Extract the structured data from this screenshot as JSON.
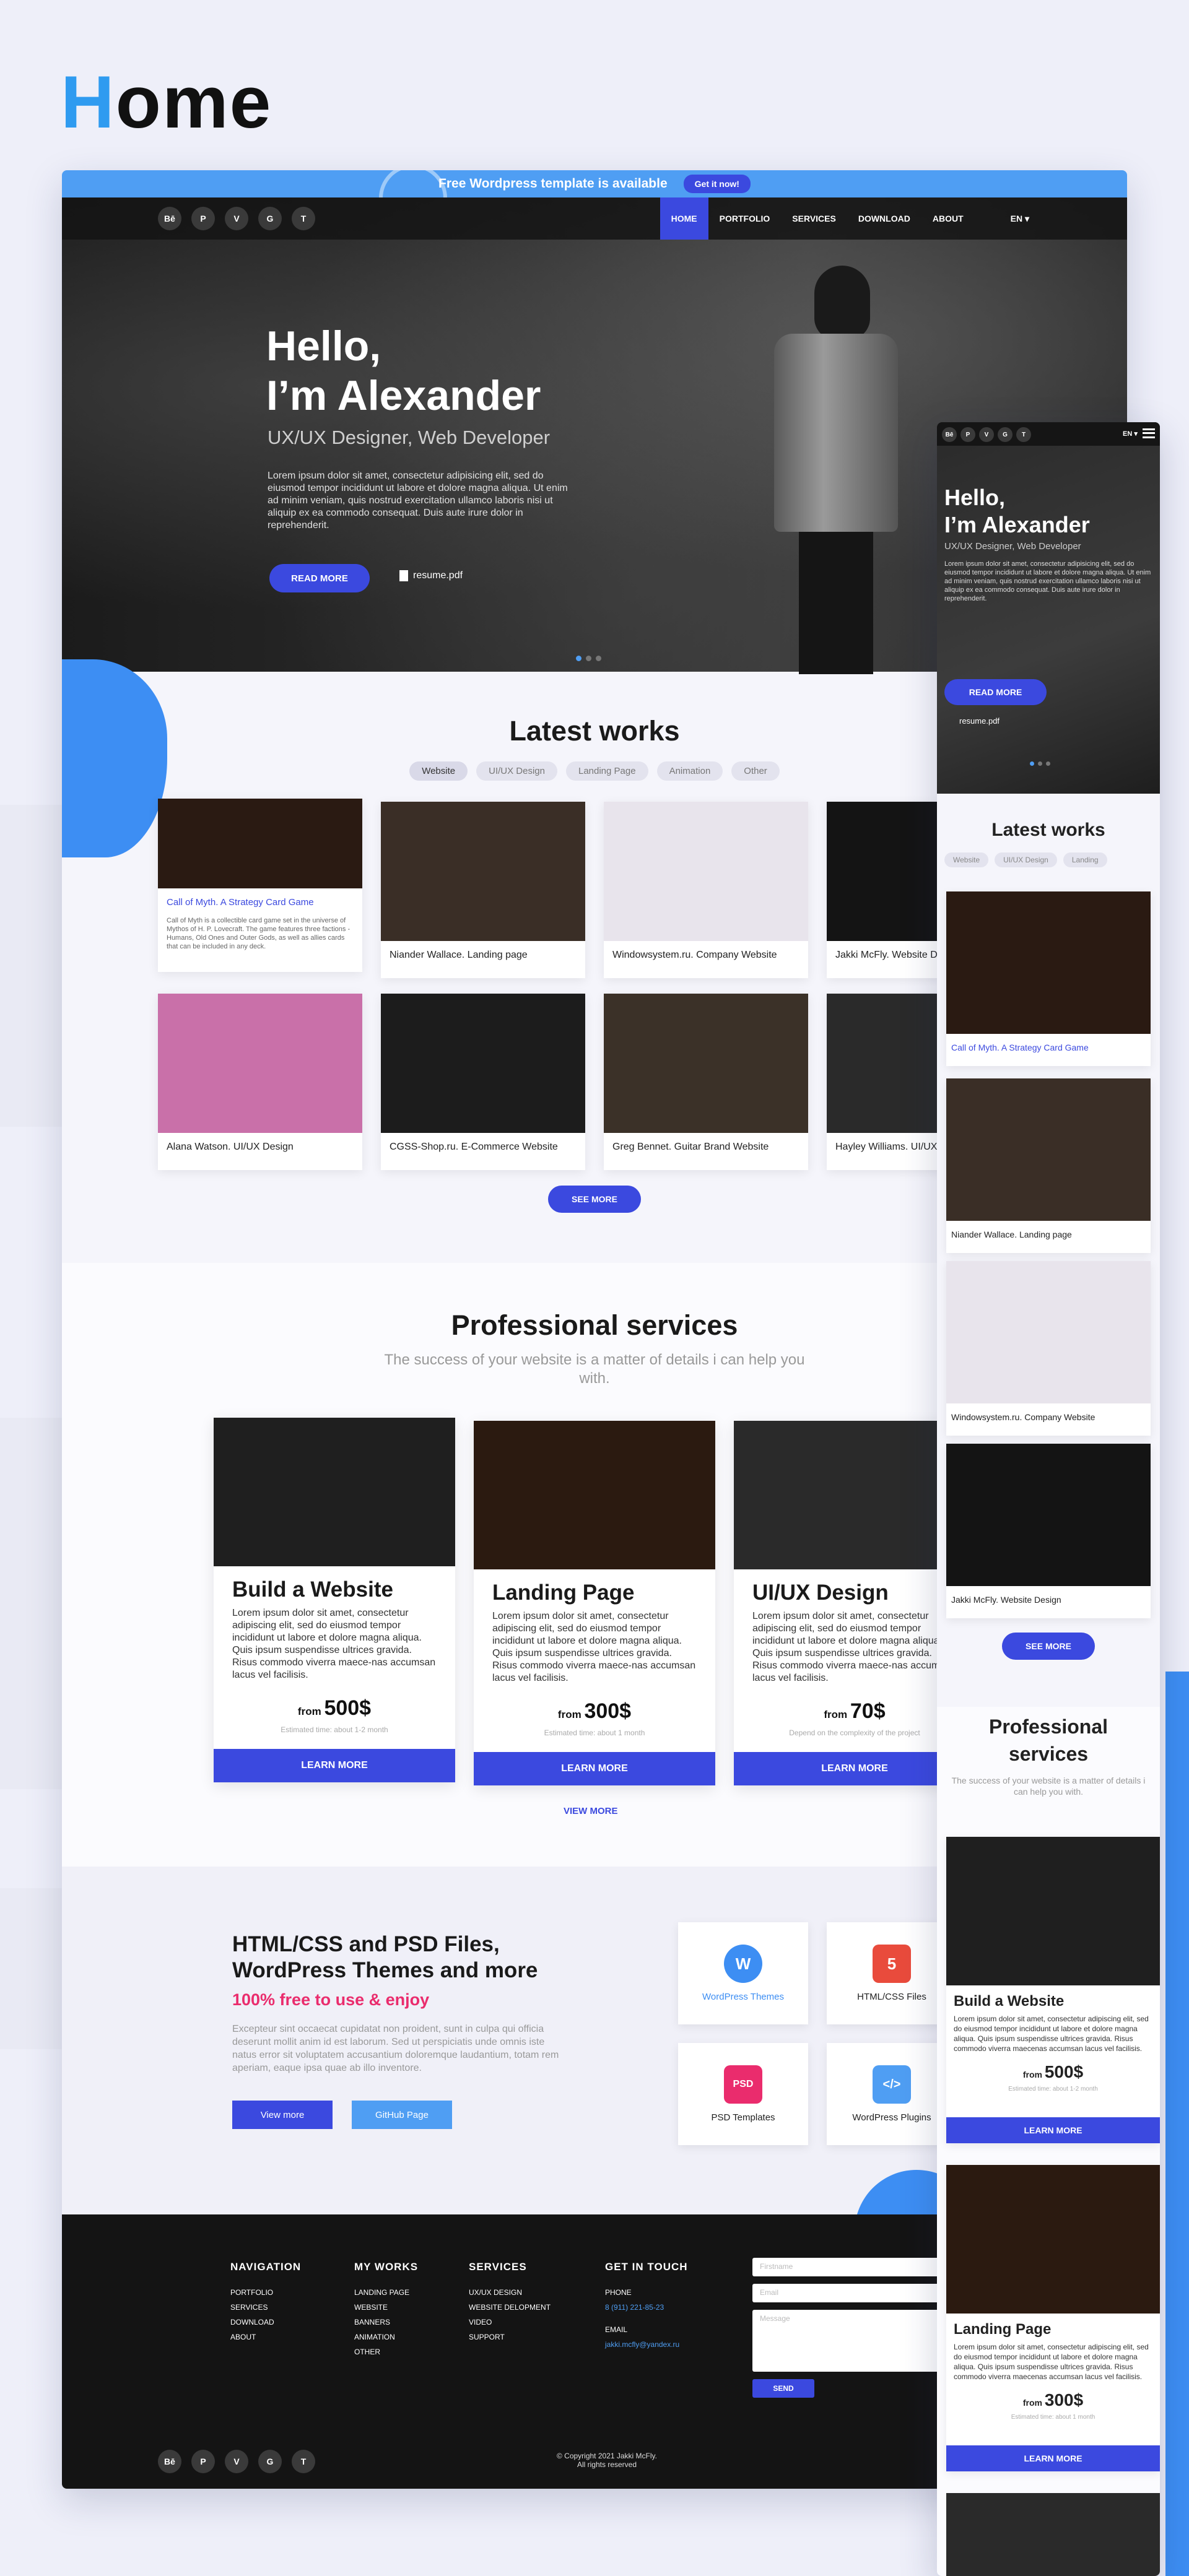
{
  "page_title": {
    "first_letter": "H",
    "rest": "ome"
  },
  "banner": {
    "text": "Free Wordpress template is available",
    "button": "Get it now!"
  },
  "nav": {
    "socials": [
      "Bē",
      "P",
      "V",
      "G",
      "T"
    ],
    "menu": [
      "HOME",
      "PORTFOLIO",
      "SERVICES",
      "DOWNLOAD",
      "ABOUT"
    ],
    "lang": "EN ▾"
  },
  "hero": {
    "hello1": "Hello,",
    "hello2": "I’m Alexander",
    "role": "UX/UX Designer, Web Developer",
    "text": "Lorem ipsum dolor sit amet, consectetur adipisicing elit, sed do eiusmod tempor incididunt ut labore et dolore magna aliqua. Ut enim ad minim veniam, quis nostrud exercitation ullamco laboris nisi ut aliquip ex ea commodo consequat. Duis aute irure dolor in reprehenderit.",
    "button": "READ MORE",
    "resume": "resume.pdf"
  },
  "works": {
    "title": "Latest works",
    "filters": [
      "Website",
      "UI/UX Design",
      "Landing Page",
      "Animation",
      "Other"
    ],
    "items": [
      {
        "caption": "Call of Myth. A Strategy Card Game",
        "desc": "Call of Myth is a collectible card game set in the universe of Mythos of H. P. Lovecraft. The game features three factions - Humans, Old Ones and Outer Gods, as well as allies cards that can be included in any deck.",
        "color": "#2a1a12"
      },
      {
        "caption": "Niander Wallace. Landing page",
        "color": "#3a2e26"
      },
      {
        "caption": "Windowsystem.ru. Company Website",
        "color": "#e8e4ec"
      },
      {
        "caption": "Jakki McFly. Website Design",
        "color": "#141414"
      },
      {
        "caption": "Alana Watson. UI/UX Design",
        "color": "#c970a9"
      },
      {
        "caption": "CGSS-Shop.ru. E-Commerce Website",
        "color": "#1c1c1c"
      },
      {
        "caption": "Greg Bennet. Guitar Brand Website",
        "color": "#3b3128"
      },
      {
        "caption": "Hayley Williams. UI/UX Design",
        "color": "#2a2a2a"
      }
    ],
    "see_more": "SEE MORE"
  },
  "services": {
    "title": "Professional services",
    "subtitle": "The success of your website is a matter of details i can help you with.",
    "items": [
      {
        "title": "Build a Website",
        "text": "Lorem ipsum dolor sit amet, consectetur adipiscing elit, sed do eiusmod tempor incididunt ut labore et dolore magna aliqua. Quis ipsum suspendisse ultrices gravida. Risus commodo viverra maece-nas accumsan lacus vel facilisis.",
        "from": "from",
        "price": "500$",
        "est": "Estimated time: about 1-2 month",
        "button": "LEARN MORE",
        "color": "#1f1f1f"
      },
      {
        "title": "Landing Page",
        "text": "Lorem ipsum dolor sit amet, consectetur adipiscing elit, sed do eiusmod tempor incididunt ut labore et dolore magna aliqua. Quis ipsum suspendisse ultrices gravida. Risus commodo viverra maece-nas accumsan lacus vel facilisis.",
        "from": "from",
        "price": "300$",
        "est": "Estimated time: about 1 month",
        "button": "LEARN MORE",
        "color": "#2b1a10"
      },
      {
        "title": "UI/UX Design",
        "text": "Lorem ipsum dolor sit amet, consectetur adipiscing elit, sed do eiusmod tempor incididunt ut labore et dolore magna aliqua. Quis ipsum suspendisse ultrices gravida. Risus commodo viverra maece-nas accumsan lacus vel facilisis.",
        "from": "from",
        "price": "70$",
        "est": "Depend on the complexity of the project",
        "button": "LEARN MORE",
        "color": "#2a2a2a"
      }
    ],
    "view_more": "VIEW MORE"
  },
  "downloads": {
    "title1": "HTML/CSS and PSD Files,",
    "title2": "WordPress Themes and more",
    "subtitle": "100% free to use & enjoy",
    "text": "Excepteur sint occaecat cupidatat non proident, sunt in culpa qui officia deserunt mollit anim id est laborum. Sed ut perspiciatis unde omnis iste natus error sit voluptatem accusantium doloremque laudantium, totam rem aperiam, eaque ipsa quae ab illo inventore.",
    "btn_view": "View more",
    "btn_github": "GitHub Page",
    "tiles": [
      {
        "label": "WordPress Themes",
        "icon": "W",
        "color": "#3d8ef3"
      },
      {
        "label": "HTML/CSS Files",
        "icon": "5",
        "color": "#e94b3c"
      },
      {
        "label": "PSD Templates",
        "icon": "PSD",
        "color": "#ea2c6d"
      },
      {
        "label": "WordPress Plugins",
        "icon": "</>",
        "color": "#4f9ef3"
      }
    ]
  },
  "footer": {
    "nav_title": "NAVIGATION",
    "nav": [
      "PORTFOLIO",
      "SERVICES",
      "DOWNLOAD",
      "ABOUT"
    ],
    "works_title": "MY WORKS",
    "works": [
      "LANDING PAGE",
      "WEBSITE",
      "BANNERS",
      "ANIMATION",
      "OTHER"
    ],
    "services_title": "SERVICES",
    "services": [
      "UX/UX DESIGN",
      "WEBSITE DELOPMENT",
      "VIDEO",
      "SUPPORT"
    ],
    "contact_title": "GET IN TOUCH",
    "phone_label": "PHONE",
    "phone": "8 (911) 221-85-23",
    "email_label": "EMAIL",
    "email": "jakki.mcfly@yandex.ru",
    "form": {
      "name": "Firstname",
      "email": "Email",
      "message": "Message",
      "send": "SEND"
    },
    "copyright1": "© Copyright 2021 Jakki McFly.",
    "copyright2": "All rights reserved"
  },
  "mobile": {
    "lang": "EN ▾",
    "hello1": "Hello,",
    "hello2": "I’m Alexander",
    "role": "UX/UX Designer, Web Developer",
    "text": "Lorem ipsum dolor sit amet, consectetur adipisicing elit, sed do eiusmod tempor incididunt ut labore et dolore magna aliqua. Ut enim ad minim veniam, quis nostrud exercitation ullamco laboris nisi ut aliquip ex ea commodo consequat. Duis aute irure dolor in reprehenderit.",
    "button": "READ MORE",
    "resume": "resume.pdf",
    "works_title": "Latest works",
    "filters": [
      "Website",
      "UI/UX Design",
      "Landing"
    ],
    "cards": [
      "Call of Myth. A Strategy Card Game",
      "Niander Wallace. Landing page",
      "Windowsystem.ru. Company Website",
      "Jakki McFly. Website Design"
    ],
    "see_more": "SEE MORE",
    "services_title": "Professional services",
    "services_sub": "The success of your website is a matter of details i can help you with.",
    "svc1_title": "Build a Website",
    "svc1_text": "Lorem ipsum dolor sit amet, consectetur adipiscing elit, sed do eiusmod tempor incididunt ut labore et dolore magna aliqua. Quis ipsum suspendisse ultrices gravida. Risus commodo viverra maecenas accumsan lacus vel facilisis.",
    "svc1_price": "500$",
    "svc1_est": "Estimated time: about 1-2 month",
    "svc2_title": "Landing Page",
    "svc2_text": "Lorem ipsum dolor sit amet, consectetur adipiscing elit, sed do eiusmod tempor incididunt ut labore et dolore magna aliqua. Quis ipsum suspendisse ultrices gravida. Risus commodo viverra maecenas accumsan lacus vel facilisis.",
    "svc2_price": "300$",
    "svc2_est": "Estimated time: about 1 month",
    "from": "from",
    "learn": "LEARN MORE"
  },
  "colors": {
    "accent": "#3b49df",
    "banner": "#4f9ef3",
    "blob": "#3d8ef3",
    "pink": "#ea2c6d"
  }
}
